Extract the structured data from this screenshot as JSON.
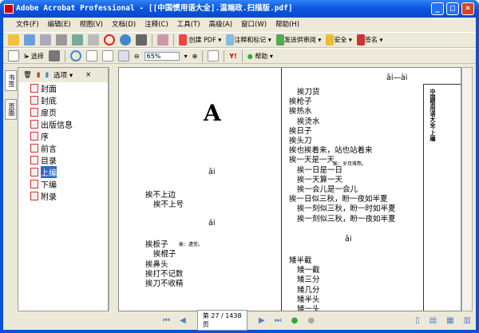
{
  "window": {
    "title": "Adobe Acrobat Professional - [[中国惯用语大全].温端政.扫描版.pdf]"
  },
  "menu": [
    "文件(F)",
    "编辑(E)",
    "视图(V)",
    "文档(D)",
    "注释(C)",
    "工具(T)",
    "高级(A)",
    "窗口(W)",
    "帮助(H)"
  ],
  "toolbar1": {
    "create_pdf": "创建 PDF",
    "comment": "注释和标记",
    "review": "发送供审阅",
    "security": "安全",
    "sign": "签名"
  },
  "toolbar2": {
    "select": "选择",
    "zoom": "65%",
    "help": "帮助"
  },
  "nav": {
    "tabs": [
      "书签",
      "页面"
    ],
    "options": "选项",
    "close": "×",
    "bookmarks": [
      "封面",
      "封底",
      "扉页",
      "出版信息",
      "序",
      "前言",
      "目录",
      "上编",
      "下编",
      "附录"
    ],
    "selected": "上编"
  },
  "page": {
    "letter": "A",
    "header": "āi—ài",
    "side_title": "中国惯用语大全·上编",
    "left": {
      "h1": "āi",
      "g1": [
        "挨不上边",
        "挨不上号"
      ],
      "h2": "ái",
      "g2": [
        "挨板子",
        "挨棍子",
        "挨鼻头",
        "挨打不记数",
        "挨刀不收精"
      ],
      "note1": "挨：遭受。"
    },
    "right": {
      "lines": [
        "挨刀货",
        "挨枪子",
        "挨热水",
        "挨烫水",
        "挨日子",
        "挨头刀",
        "挨也挨着来，站也站着来",
        "挨一天是一天",
        "挨一日是一日",
        "挨一天算一天",
        "挨一会儿是一会儿",
        "挨一日似三秋，盼一夜如半夏",
        "挨一刻似三秋，盼一时如半夏",
        "挨一刻似三秋，盼一夜如半夏"
      ],
      "note": "挨：岁月难熬。",
      "h": "ǎi",
      "g": [
        "矮半截",
        "矮一截",
        "矮三分",
        "矮几分",
        "矮半头",
        "矮一头"
      ]
    }
  },
  "status": {
    "page": "第 27 / 1438 页"
  }
}
